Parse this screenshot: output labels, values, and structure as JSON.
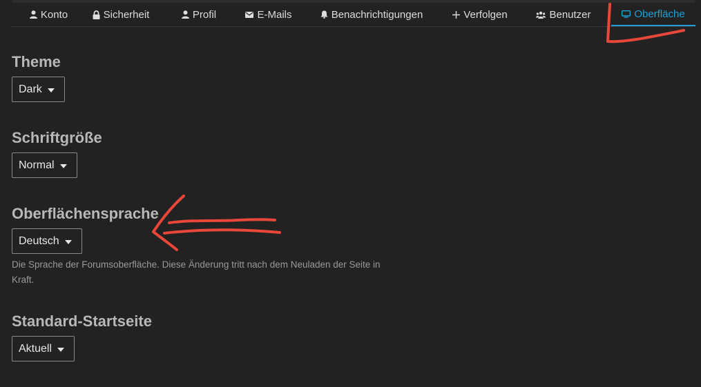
{
  "tabs": [
    {
      "label": "Konto",
      "icon": "user-icon",
      "active": false
    },
    {
      "label": "Sicherheit",
      "icon": "lock-icon",
      "active": false
    },
    {
      "label": "Profil",
      "icon": "user-icon",
      "active": false
    },
    {
      "label": "E-Mails",
      "icon": "envelope-icon",
      "active": false
    },
    {
      "label": "Benachrichtigungen",
      "icon": "bell-icon",
      "active": false
    },
    {
      "label": "Verfolgen",
      "icon": "plus-icon",
      "active": false
    },
    {
      "label": "Benutzer",
      "icon": "users-icon",
      "active": false
    },
    {
      "label": "Oberfläche",
      "icon": "desktop-icon",
      "active": true
    }
  ],
  "sections": {
    "theme": {
      "title": "Theme",
      "value": "Dark"
    },
    "font_size": {
      "title": "Schriftgröße",
      "value": "Normal"
    },
    "language": {
      "title": "Oberflächensprache",
      "value": "Deutsch",
      "help": "Die Sprache der Forumsoberfläche. Diese Änderung tritt nach dem Neuladen der Seite in Kraft."
    },
    "homepage": {
      "title": "Standard-Startseite",
      "value": "Aktuell"
    }
  },
  "colors": {
    "background": "#222222",
    "accent": "#1ea0d6",
    "annotation": "#e8473a"
  }
}
